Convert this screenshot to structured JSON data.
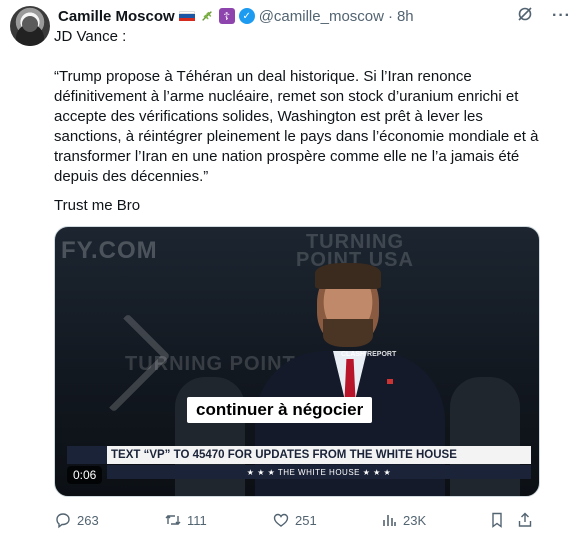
{
  "author": {
    "name": "Camille Moscow",
    "handle": "@camille_moscow",
    "separator": "·",
    "time": "8h",
    "flag_colors": [
      "#ffffff",
      "#1c57a5",
      "#d52b1e"
    ],
    "badges": [
      "russia-flag-icon",
      "olive-branch-icon",
      "orthodox-cross-icon",
      "verified-badge-icon"
    ]
  },
  "post": {
    "intro": "JD Vance :",
    "quote": "“Trump propose à Téhéran un deal historique. Si l’Iran renonce définitivement à l’arme nucléaire, remet son stock d’uranium enrichi et accepte des vérifications solides, Washington est prêt à lever les sanctions, à réintégrer pleinement le pays dans l’économie mondiale et à transformer l’Iran en une nation prospère comme elle ne l’a jamais été depuis des décennies.”",
    "outro": "Trust me Bro"
  },
  "video": {
    "caption": "continuer à négocier",
    "banner_text": "TEXT “VP” TO 45470 FOR UPDATES FROM THE WHITE HOUSE",
    "banner_sub": "★ ★ ★  THE WHITE HOUSE  ★ ★ ★",
    "bg_text_1": "FY.COM",
    "bg_text_2": "TURNING POINT USA",
    "bg_text_3": "TURNING POINT U",
    "logo_mini": "CLASH REPORT",
    "timer": "0:06"
  },
  "actions": {
    "replies": "263",
    "reposts": "111",
    "likes": "251",
    "views": "23K"
  }
}
